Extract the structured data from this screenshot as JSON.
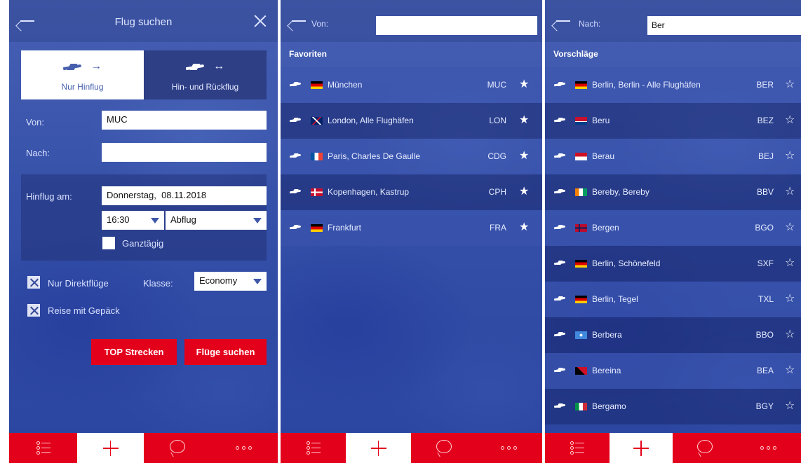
{
  "colors": {
    "brand_red": "#e3001b",
    "panel_blue": "#3450a8"
  },
  "icons": [
    "back-arrow-icon",
    "close-icon",
    "plane-icon",
    "arrow-right-icon",
    "arrow-both-icon",
    "chevron-down-icon",
    "star-icon",
    "list-icon",
    "plus-icon",
    "chat-icon",
    "more-icon"
  ],
  "search_form": {
    "title": "Flug suchen",
    "trip_one_way": "Nur Hinflug",
    "trip_round": "Hin- und Rückflug",
    "from_label": "Von:",
    "from_value": "MUC",
    "to_label": "Nach:",
    "to_value": "",
    "depart_label": "Hinflug am:",
    "depart_weekday": "Donnerstag,",
    "depart_date": "08.11.2018",
    "depart_time": "16:30",
    "time_mode": "Abflug",
    "all_day_label": "Ganztägig",
    "direct_label": "Nur Direktflüge",
    "class_label": "Klasse:",
    "class_value": "Economy",
    "luggage_label": "Reise mit Gepäck",
    "top_routes_button": "TOP Strecken",
    "search_button": "Flüge suchen"
  },
  "from_picker": {
    "label": "Von:",
    "value": "",
    "section_title": "Favoriten",
    "items": [
      {
        "name": "München",
        "code": "MUC",
        "flag": "de"
      },
      {
        "name": "London, Alle Flughäfen",
        "code": "LON",
        "flag": "gb"
      },
      {
        "name": "Paris, Charles De Gaulle",
        "code": "CDG",
        "flag": "fr"
      },
      {
        "name": "Kopenhagen, Kastrup",
        "code": "CPH",
        "flag": "dk"
      },
      {
        "name": "Frankfurt",
        "code": "FRA",
        "flag": "de"
      }
    ]
  },
  "to_picker": {
    "label": "Nach:",
    "value": "Ber",
    "section_title": "Vorschläge",
    "items": [
      {
        "name": "Berlin, Berlin - Alle Flughäfen",
        "code": "BER",
        "flag": "de"
      },
      {
        "name": "Beru",
        "code": "BEZ",
        "flag": "ki"
      },
      {
        "name": "Berau",
        "code": "BEJ",
        "flag": "id"
      },
      {
        "name": "Bereby, Bereby",
        "code": "BBV",
        "flag": "ci"
      },
      {
        "name": "Bergen",
        "code": "BGO",
        "flag": "no"
      },
      {
        "name": "Berlin, Schönefeld",
        "code": "SXF",
        "flag": "de"
      },
      {
        "name": "Berlin, Tegel",
        "code": "TXL",
        "flag": "de"
      },
      {
        "name": "Berbera",
        "code": "BBO",
        "flag": "so"
      },
      {
        "name": "Bereina",
        "code": "BEA",
        "flag": "pg"
      },
      {
        "name": "Bergamo",
        "code": "BGY",
        "flag": "it"
      }
    ]
  },
  "tabbar": {
    "more_dots": "ooo"
  }
}
